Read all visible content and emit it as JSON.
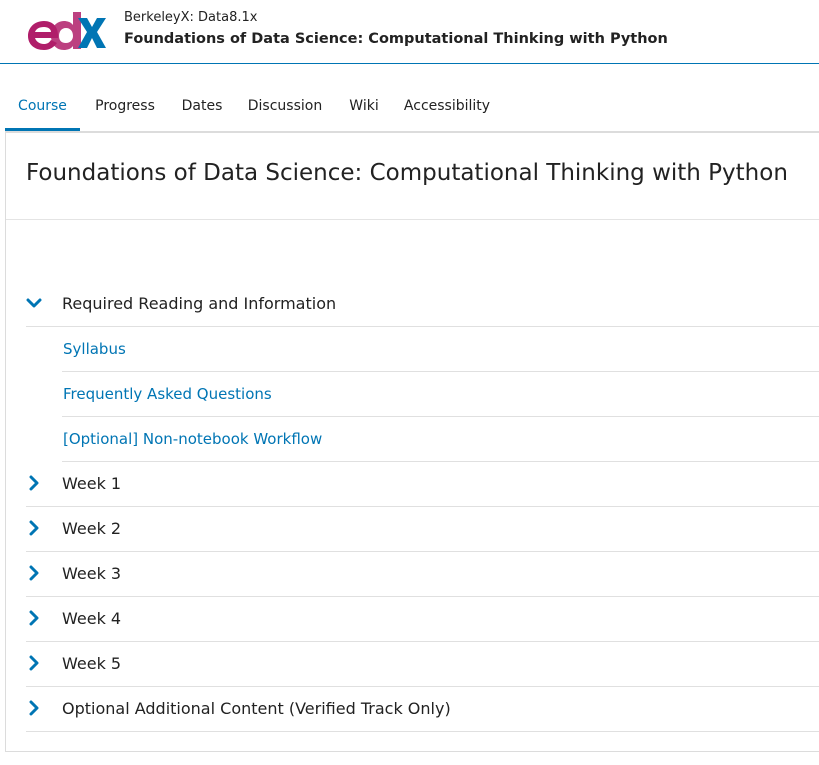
{
  "header": {
    "org_line": "BerkeleyX: Data8.1x",
    "course_title": "Foundations of Data Science: Computational Thinking with Python",
    "logo_icon": "edx-logo-icon",
    "brand_colors": {
      "logo_left": "#b01e6a",
      "logo_right": "#0075b4"
    }
  },
  "tabs": [
    {
      "label": "Course",
      "active": true
    },
    {
      "label": "Progress"
    },
    {
      "label": "Dates"
    },
    {
      "label": "Discussion"
    },
    {
      "label": "Wiki"
    },
    {
      "label": "Accessibility"
    }
  ],
  "main": {
    "page_title": "Foundations of Data Science: Computational Thinking with Python",
    "sections": [
      {
        "label": "Required Reading and Information",
        "expanded": true,
        "icon": "chevron-down-icon",
        "subsections": [
          {
            "label": "Syllabus"
          },
          {
            "label": "Frequently Asked Questions"
          },
          {
            "label": "[Optional] Non-notebook Workflow"
          }
        ]
      },
      {
        "label": "Week 1",
        "icon": "chevron-right-icon"
      },
      {
        "label": "Week 2",
        "icon": "chevron-right-icon"
      },
      {
        "label": "Week 3",
        "icon": "chevron-right-icon"
      },
      {
        "label": "Week 4",
        "icon": "chevron-right-icon"
      },
      {
        "label": "Week 5",
        "icon": "chevron-right-icon"
      },
      {
        "label": "Optional Additional Content (Verified Track Only)",
        "icon": "chevron-right-icon"
      }
    ]
  },
  "colors": {
    "accent": "#0075b4",
    "text": "#222222",
    "divider": "#e0e0e0"
  }
}
